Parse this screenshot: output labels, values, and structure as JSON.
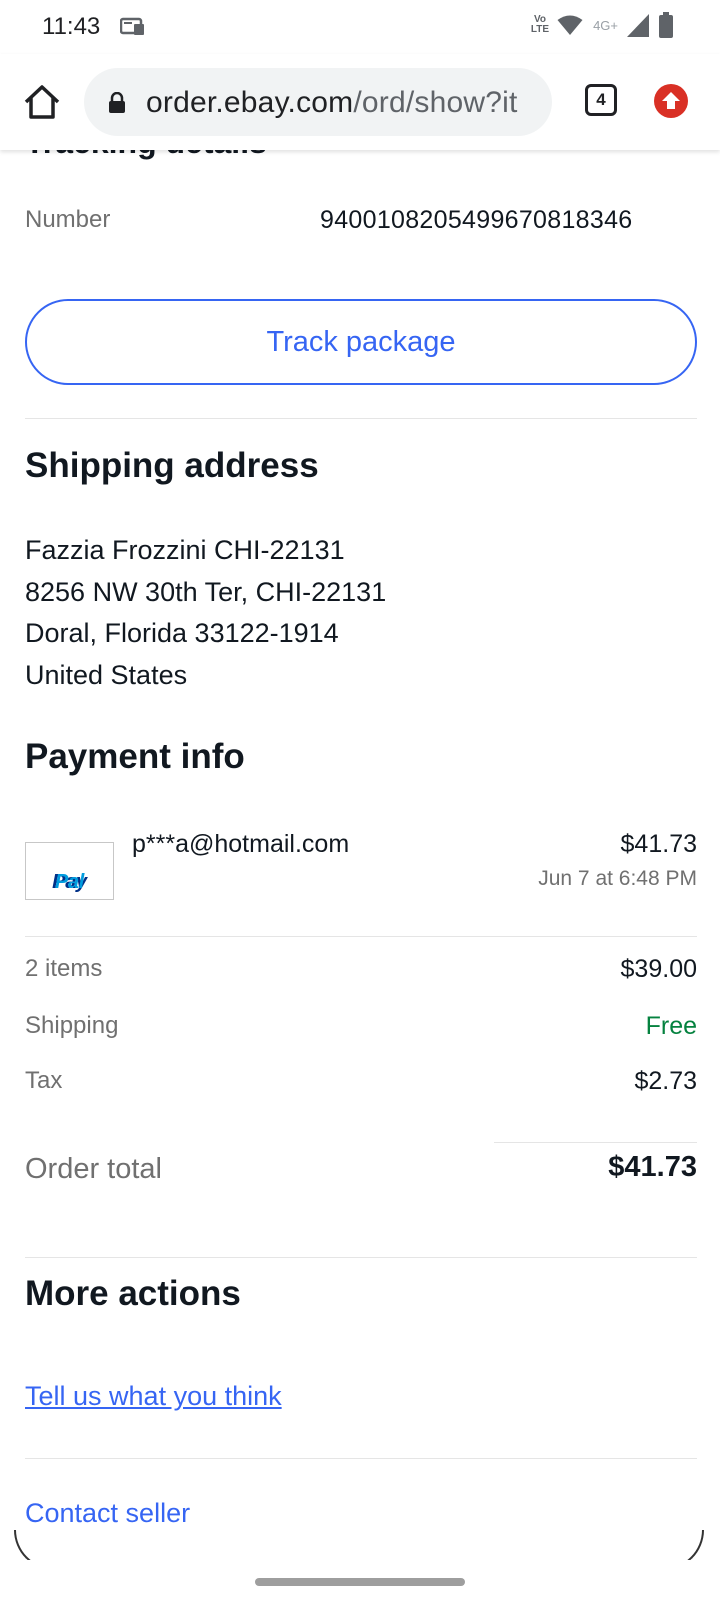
{
  "status_bar": {
    "time": "11:43",
    "volte_label": "VoLTE",
    "network_label": "4G+",
    "icons": [
      "notification-icon",
      "wifi-icon",
      "signal-icon",
      "battery-icon"
    ]
  },
  "browser": {
    "url_host": "order.ebay.com",
    "url_path": "/ord/show?it",
    "tab_count": "4",
    "icons": [
      "home-icon",
      "lock-icon",
      "update-icon"
    ]
  },
  "tracking": {
    "heading": "Tracking details",
    "number_label": "Number",
    "number_value": "9400108205499670818346",
    "track_button": "Track package"
  },
  "shipping": {
    "heading": "Shipping address",
    "lines": [
      "Fazzia Frozzini CHI-22131",
      "8256 NW 30th Ter, CHI-22131",
      "Doral, Florida 33122-1914",
      "United States"
    ]
  },
  "payment": {
    "heading": "Payment info",
    "logo_text_1": "Pay",
    "logo_text_2": "Pal",
    "email": "p***a@hotmail.com",
    "amount": "$41.73",
    "date": "Jun 7 at 6:48 PM"
  },
  "summary": {
    "items_label": "2 items",
    "items_value": "$39.00",
    "shipping_label": "Shipping",
    "shipping_value": "Free",
    "tax_label": "Tax",
    "tax_value": "$2.73",
    "total_label": "Order total",
    "total_value": "$41.73"
  },
  "more_actions": {
    "heading": "More actions",
    "feedback_link": "Tell us what you think",
    "contact_link": "Contact seller"
  },
  "colors": {
    "link": "#3665f3",
    "free": "#05823f",
    "muted": "#707070",
    "text": "#111820"
  }
}
